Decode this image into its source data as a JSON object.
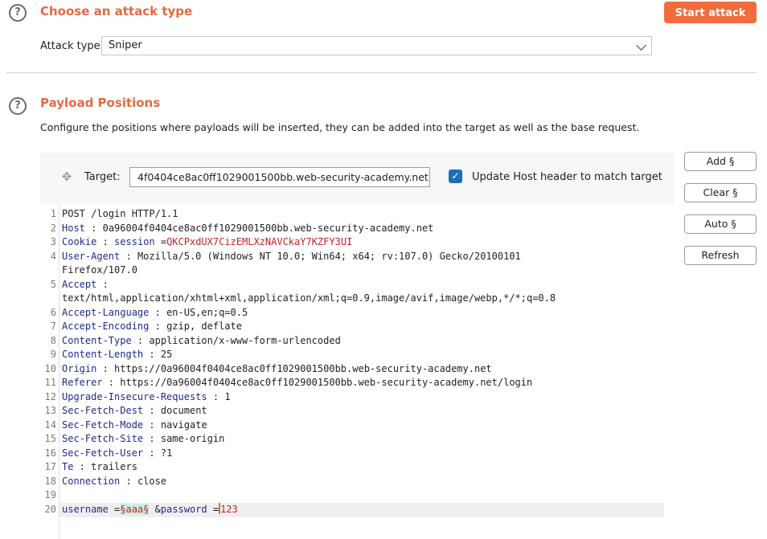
{
  "attack_section": {
    "title": "Choose an attack type",
    "start_label": "Start attack",
    "attack_type_label": "Attack type:",
    "attack_type_value": "Sniper"
  },
  "positions_section": {
    "title": "Payload Positions",
    "description": "Configure the positions where payloads will be inserted, they can be added into the target as well as the base request.",
    "target_label": "Target:",
    "target_value": "4f0404ce8ac0ff1029001500bb.web-security-academy.net",
    "update_host_label": "Update Host header to match target",
    "update_host_checked": true
  },
  "buttons": {
    "add": "Add §",
    "clear": "Clear §",
    "auto": "Auto §",
    "refresh": "Refresh"
  },
  "request": {
    "l1": "POST /login HTTP/1.1",
    "l2_key": "Host",
    "l2_val": "0a96004f0404ce8ac0ff1029001500bb.web-security-academy.net",
    "l3_key": "Cookie",
    "l3_ck": "session",
    "l3_cv": "QKCPxdUX7CizEMLXzNAVCkaY7KZFY3UI",
    "l4_key": "User-Agent",
    "l4_val": "Mozilla/5.0 (Windows NT 10.0; Win64; x64; rv:107.0) Gecko/20100101",
    "l4_cont": "Firefox/107.0",
    "l5_key": "Accept",
    "l5_cont": "text/html,application/xhtml+xml,application/xml;q=0.9,image/avif,image/webp,*/*;q=0.8",
    "l6_key": "Accept-Language",
    "l6_val": "en-US,en;q=0.5",
    "l7_key": "Accept-Encoding",
    "l7_val": "gzip, deflate",
    "l8_key": "Content-Type",
    "l8_val": "application/x-www-form-urlencoded",
    "l9_key": "Content-Length",
    "l9_val": "25",
    "l10_key": "Origin",
    "l10_val": "https://0a96004f0404ce8ac0ff1029001500bb.web-security-academy.net",
    "l11_key": "Referer",
    "l11_val": "https://0a96004f0404ce8ac0ff1029001500bb.web-security-academy.net/login",
    "l12_key": "Upgrade-Insecure-Requests",
    "l12_val": "1",
    "l13_key": "Sec-Fetch-Dest",
    "l13_val": "document",
    "l14_key": "Sec-Fetch-Mode",
    "l14_val": "navigate",
    "l15_key": "Sec-Fetch-Site",
    "l15_val": "same-origin",
    "l16_key": "Sec-Fetch-User",
    "l16_val": "?1",
    "l17_key": "Te",
    "l17_val": "trailers",
    "l18_key": "Connection",
    "l18_val": "close",
    "l20_k1": "username",
    "l20_payload": "§aaa§",
    "l20_k2": "password",
    "l20_v2": "123"
  },
  "colors": {
    "accent": "#f26b3a",
    "header_key": "#1f2a8c",
    "cookie_value": "#c0242c",
    "checkbox": "#1d6fb8"
  }
}
